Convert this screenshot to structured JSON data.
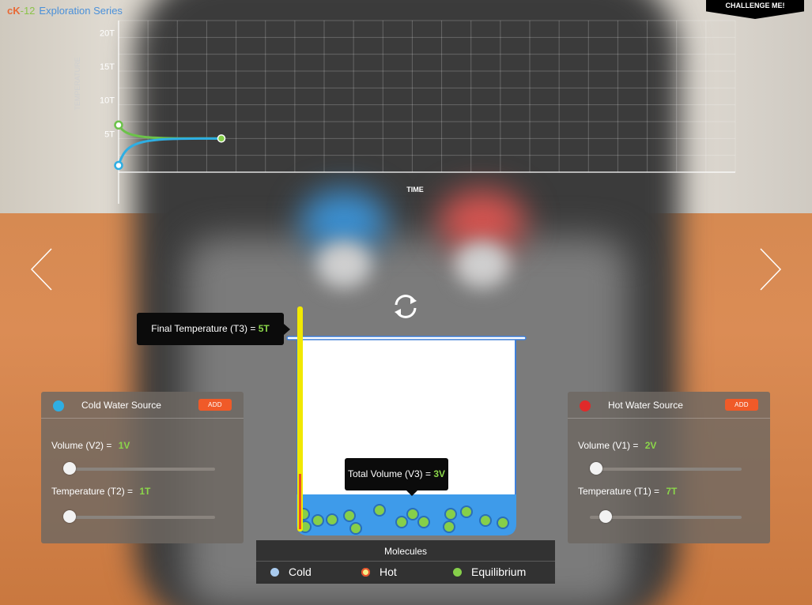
{
  "header": {
    "logo_ck": "cK",
    "logo_num": "-12",
    "series": "Exploration Series",
    "challenge_label": "CHALLENGE ME!"
  },
  "graph": {
    "y_axis_label": "TEMPERATURE",
    "x_axis_label": "TIME",
    "y_ticks": [
      "20T",
      "15T",
      "10T",
      "5T"
    ]
  },
  "chart_data": {
    "type": "line",
    "xlabel": "TIME",
    "ylabel": "TEMPERATURE",
    "yticks": [
      "5T",
      "10T",
      "15T",
      "20T"
    ],
    "ylim": [
      0,
      22.5
    ],
    "xlim": [
      0,
      21
    ],
    "grid": true,
    "series": [
      {
        "color": "#6cc24a",
        "start": [
          0,
          7
        ],
        "end": [
          3.5,
          5
        ]
      },
      {
        "color": "#2eaee3",
        "start": [
          0,
          1
        ],
        "end": [
          3.5,
          5
        ]
      }
    ]
  },
  "final_temp": {
    "label": "Final Temperature (T3) = ",
    "value": "5T"
  },
  "total_volume": {
    "label": "Total Volume (V3) = ",
    "value": "3V"
  },
  "cold_panel": {
    "title": "Cold Water Source",
    "add_label": "ADD",
    "dot_color": "#2eaee3",
    "volume_label": "Volume (V2) = ",
    "volume_value": "1V",
    "volume_level": 0,
    "temp_label": "Temperature (T2) = ",
    "temp_value": "1T",
    "temp_level": 0
  },
  "hot_panel": {
    "title": "Hot Water Source",
    "add_label": "ADD",
    "dot_color": "#e02a2a",
    "volume_label": "Volume (V1) = ",
    "volume_value": "2V",
    "volume_level": 0,
    "temp_label": "Temperature (T1) = ",
    "temp_value": "7T",
    "temp_level": 0.07
  },
  "legend": {
    "title": "Molecules",
    "items": [
      {
        "label": "Cold",
        "color": "#a9cbef"
      },
      {
        "label": "Hot",
        "color": "#f5ef88"
      },
      {
        "label": "Equilibrium",
        "color": "#86cf4a"
      }
    ]
  },
  "colors": {
    "accent_green": "#8bd64a",
    "add_orange": "#f05a28",
    "water": "#3e9bea"
  }
}
